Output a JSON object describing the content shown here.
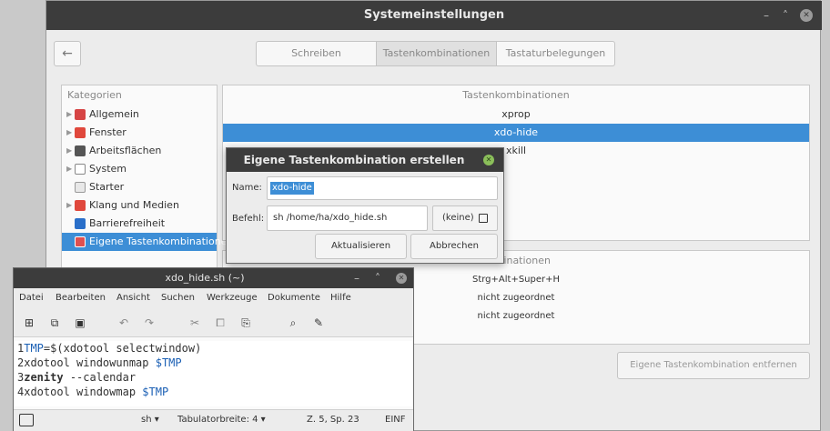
{
  "main": {
    "title": "Systemeinstellungen",
    "tabs": [
      "Schreiben",
      "Tastenkombinationen",
      "Tastaturbelegungen"
    ]
  },
  "categories": {
    "header": "Kategorien",
    "items": [
      {
        "label": "Allgemein",
        "color": "#d64545"
      },
      {
        "label": "Fenster",
        "color": "#e0483c"
      },
      {
        "label": "Arbeitsflächen",
        "color": "#555555"
      },
      {
        "label": "System",
        "color": "#888888"
      },
      {
        "label": "Starter",
        "color": "#9a9a9a"
      },
      {
        "label": "Klang und Medien",
        "color": "#e0483c"
      },
      {
        "label": "Barrierefreiheit",
        "color": "#2a6fc9"
      },
      {
        "label": "Eigene Tastenkombinationen",
        "color": "#e05050"
      }
    ]
  },
  "shortcuts": {
    "header": "Tastenkombinationen",
    "rows": [
      "xprop",
      "xdo-hide",
      "xkill"
    ]
  },
  "bindings": {
    "header": "ombinationen",
    "rows": [
      "Strg+Alt+Super+H",
      "nicht zugeordnet",
      "nicht zugeordnet"
    ]
  },
  "remove_button": "Eigene Tastenkombination entfernen",
  "dialog": {
    "title": "Eigene Tastenkombination erstellen",
    "name_label": "Name:",
    "name_value": "xdo-hide",
    "cmd_label": "Befehl:",
    "cmd_value": "sh /home/ha/xdo_hide.sh",
    "file_label": "(keine)",
    "update_button": "Aktualisieren",
    "cancel_button": "Abbrechen"
  },
  "editor": {
    "title": "xdo_hide.sh (~)",
    "menu": [
      "Datei",
      "Bearbeiten",
      "Ansicht",
      "Suchen",
      "Werkzeuge",
      "Dokumente",
      "Hilfe"
    ],
    "code": [
      {
        "n": "1",
        "a": "TMP",
        "b": "=$(xdotool selectwindow)"
      },
      {
        "n": "2",
        "a": "xdotool windowunmap ",
        "b": "$TMP"
      },
      {
        "n": "3",
        "a": "zenity",
        "b": " --calendar"
      },
      {
        "n": "4",
        "a": "xdotool windowmap ",
        "b": "$TMP"
      }
    ],
    "status": {
      "lang": "sh ▾",
      "tab": "Tabulatorbreite: 4 ▾",
      "pos": "Z. 5, Sp. 23",
      "mode": "EINF"
    }
  }
}
